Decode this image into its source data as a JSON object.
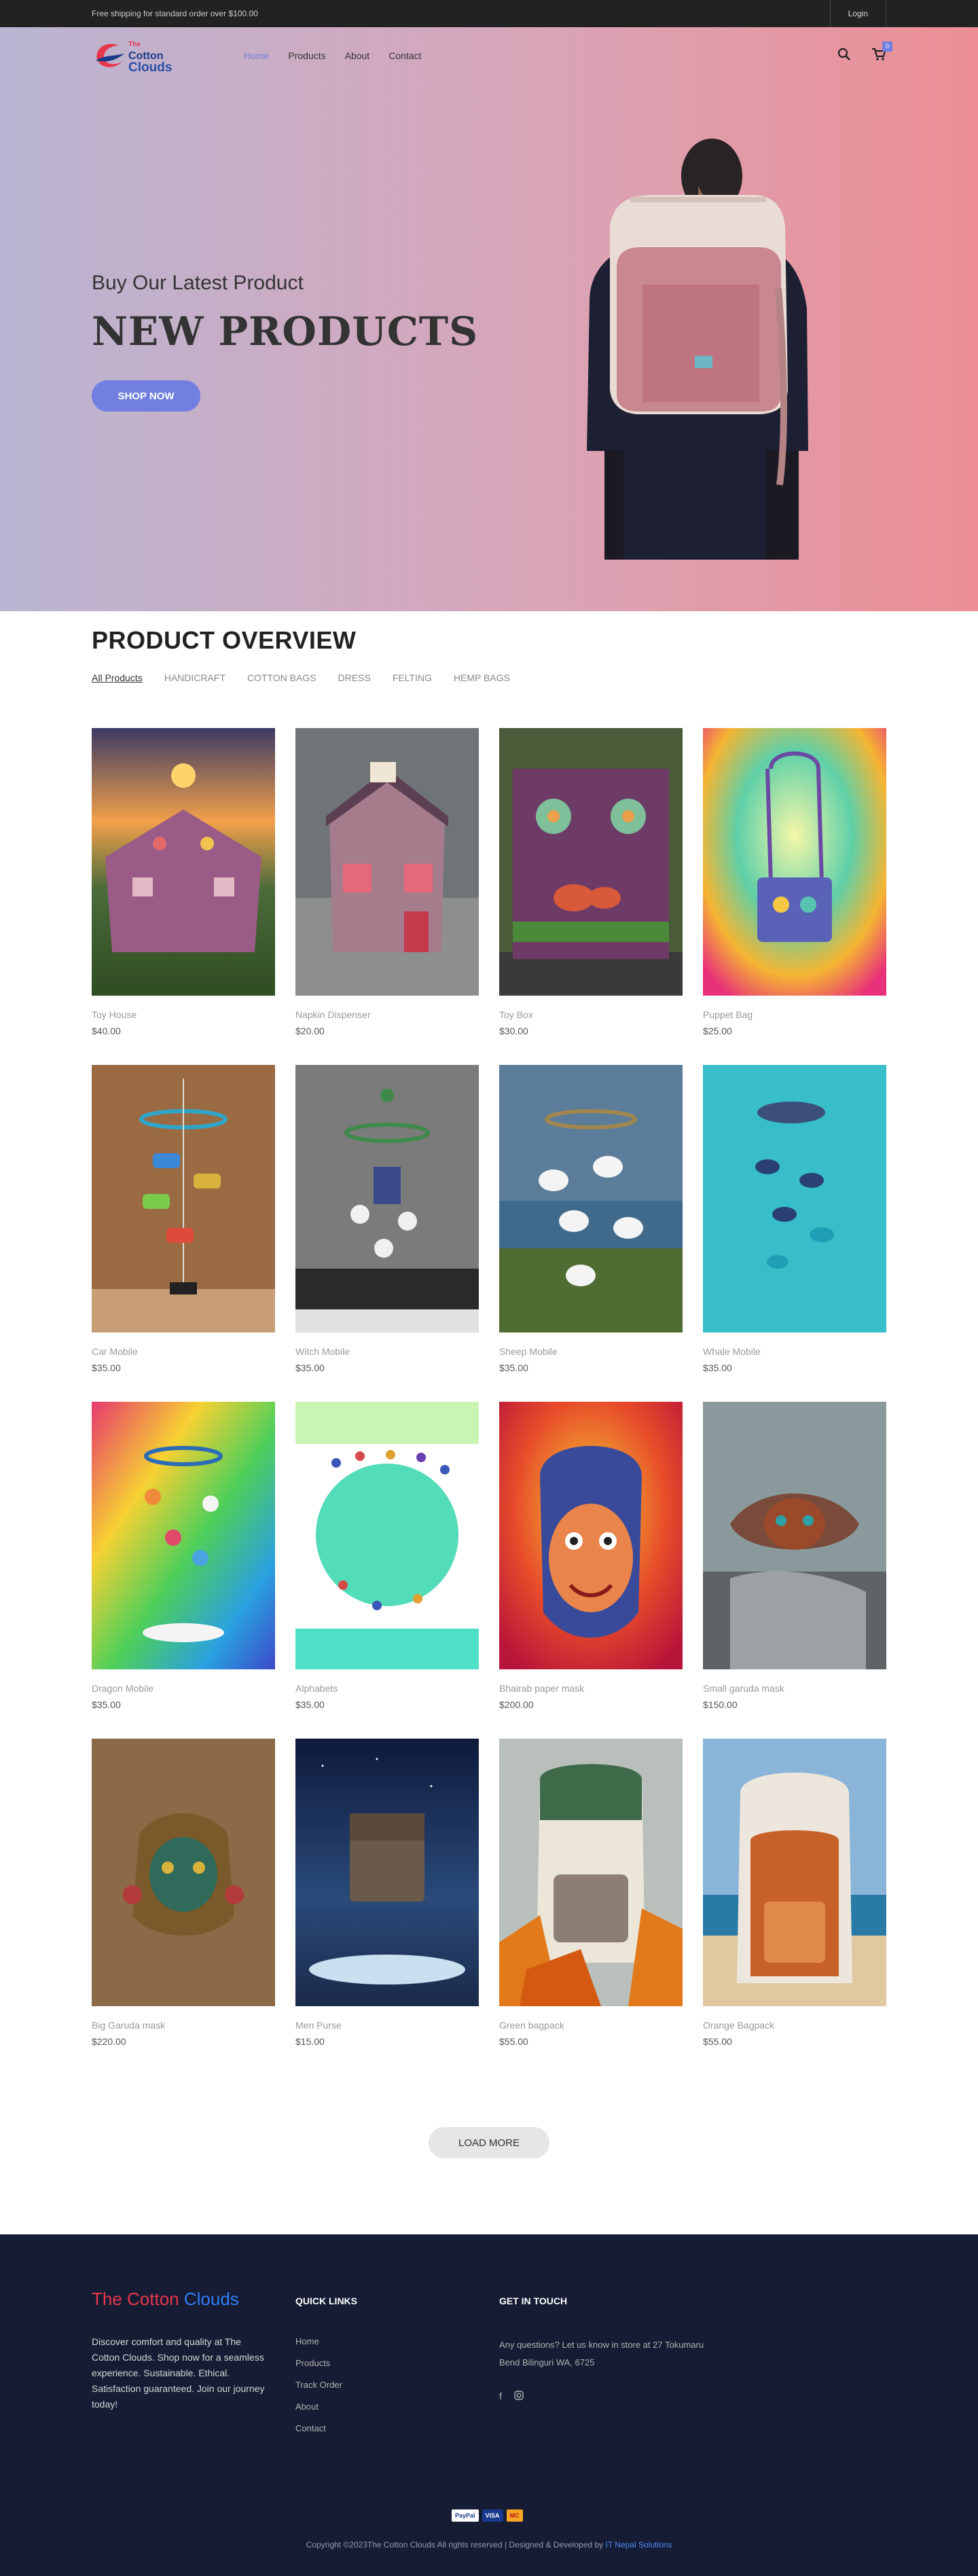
{
  "topbar": {
    "shipping": "Free shipping for standard order over $100.00",
    "login": "Login"
  },
  "nav": {
    "logo_line1": "The",
    "logo_line2": "Cotton",
    "logo_line3": "Clouds",
    "items": [
      {
        "label": "Home",
        "active": true
      },
      {
        "label": "Products",
        "active": false
      },
      {
        "label": "About",
        "active": false
      },
      {
        "label": "Contact",
        "active": false
      }
    ],
    "cart_count": "0",
    "icons": [
      "search-icon",
      "cart-icon"
    ]
  },
  "hero": {
    "subtitle": "Buy Our Latest Product",
    "title": "NEW PRODUCTS",
    "button": "SHOP NOW"
  },
  "overview": {
    "title": "PRODUCT OVERVIEW",
    "filters": [
      "All Products",
      "HANDICRAFT",
      "COTTON BAGS",
      "DRESS",
      "FELTING",
      "HEMP BAGS"
    ],
    "products": [
      {
        "name": "Toy House",
        "price": "$40.00"
      },
      {
        "name": "Napkin Dispenser",
        "price": "$20.00"
      },
      {
        "name": "Toy Box",
        "price": "$30.00"
      },
      {
        "name": "Puppet Bag",
        "price": "$25.00"
      },
      {
        "name": "Car Mobile",
        "price": "$35.00"
      },
      {
        "name": "Witch Mobile",
        "price": "$35.00"
      },
      {
        "name": "Sheep Mobile",
        "price": "$35.00"
      },
      {
        "name": "Whale Mobile",
        "price": "$35.00"
      },
      {
        "name": "Dragon Mobile",
        "price": "$35.00"
      },
      {
        "name": "Alphabets",
        "price": "$35.00"
      },
      {
        "name": "Bhairab paper mask",
        "price": "$200.00"
      },
      {
        "name": "Small garuda mask",
        "price": "$150.00"
      },
      {
        "name": "Big Garuda mask",
        "price": "$220.00"
      },
      {
        "name": "Men Purse",
        "price": "$15.00"
      },
      {
        "name": "Green bagpack",
        "price": "$55.00"
      },
      {
        "name": "Orange Bagpack",
        "price": "$55.00"
      }
    ],
    "load_more": "LOAD MORE"
  },
  "footer": {
    "brand_a": "The Cotton",
    "brand_b": "Clouds",
    "description": "Discover comfort and quality at The Cotton Clouds. Shop now for a seamless experience. Sustainable. Ethical. Satisfaction guaranteed. Join our journey today!",
    "quick_links_title": "QUICK LINKS",
    "quick_links": [
      "Home",
      "Products",
      "Track Order",
      "About",
      "Contact"
    ],
    "contact_title": "GET IN TOUCH",
    "contact_text": "Any questions? Let us know in store at 27 Tokumaru Bend Bilinguri WA, 6725",
    "social_icons": [
      "facebook-icon",
      "instagram-icon"
    ],
    "payments": [
      "PayPal",
      "VISA",
      "MC"
    ],
    "copyright": "Copyright ©2023The Cotton Clouds All rights reserved | Designed & Developed by",
    "developer": "IT Nepal Solutions"
  },
  "colors": {
    "accent": "#717fe0",
    "footer_bg": "#151c33",
    "topbar_bg": "#222222"
  }
}
